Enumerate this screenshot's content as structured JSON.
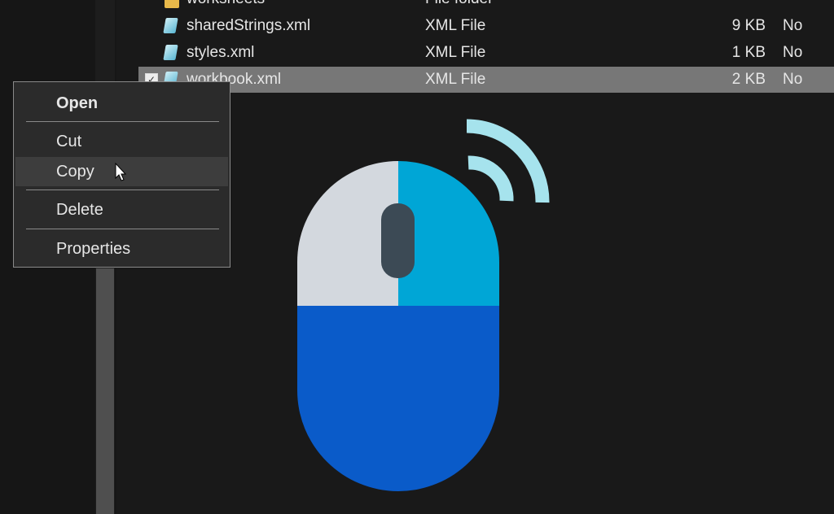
{
  "files": [
    {
      "name": "worksheets",
      "type": "File folder",
      "size": "",
      "available": "",
      "icon": "folder-icon"
    },
    {
      "name": "sharedStrings.xml",
      "type": "XML File",
      "size": "9 KB",
      "available": "No",
      "icon": "xml-file-icon"
    },
    {
      "name": "styles.xml",
      "type": "XML File",
      "size": "1 KB",
      "available": "No",
      "icon": "xml-file-icon"
    },
    {
      "name": "workbook.xml",
      "type": "XML File",
      "size": "2 KB",
      "available": "No",
      "icon": "xml-file-icon",
      "selected": true
    }
  ],
  "context_menu": {
    "items": [
      "Open",
      "Cut",
      "Copy",
      "Delete",
      "Properties"
    ],
    "hovered": "Copy"
  },
  "illustration": {
    "name": "wireless-mouse",
    "colors": {
      "left_button": "#d3d8de",
      "right_button": "#00a6d6",
      "body": "#0a5bc9",
      "wheel": "#3c4a55",
      "signal": "#a6e3ed"
    }
  }
}
